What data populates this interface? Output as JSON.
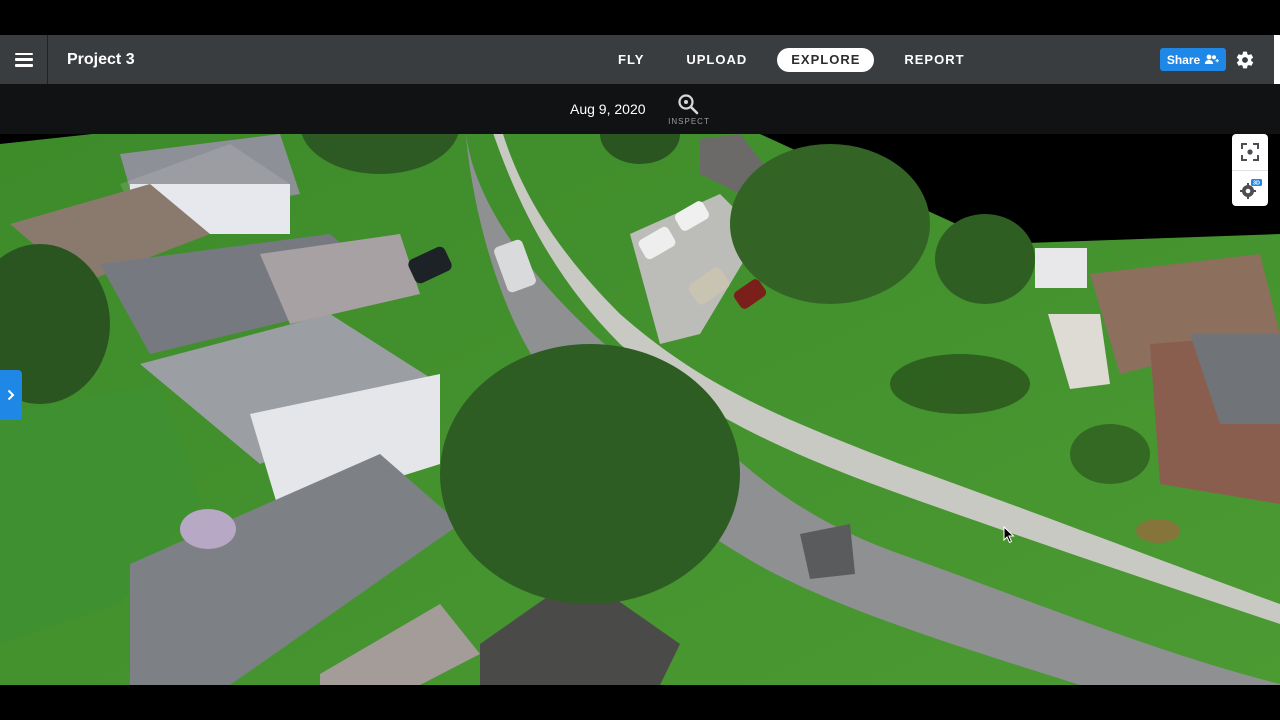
{
  "app": {
    "project_title": "Project 3",
    "menu_icon": "hamburger-icon"
  },
  "nav": {
    "tabs": [
      {
        "label": "FLY",
        "active": false
      },
      {
        "label": "UPLOAD",
        "active": false
      },
      {
        "label": "EXPLORE",
        "active": true
      },
      {
        "label": "REPORT",
        "active": false
      }
    ],
    "share_label": "Share",
    "share_icon": "add-people-icon",
    "settings_icon": "gear-icon"
  },
  "datebar": {
    "date": "Aug 9, 2020",
    "inspect_label": "INSPECT",
    "inspect_icon": "magnifier-icon"
  },
  "side_controls": {
    "recenter_icon": "focus-frame-icon",
    "view_settings_icon": "gear-icon",
    "view_settings_badge": "3D"
  },
  "colors": {
    "topbar": "#3a3d40",
    "datebar": "#111214",
    "accent": "#1f87e6",
    "active_tab_bg": "#ffffff"
  }
}
